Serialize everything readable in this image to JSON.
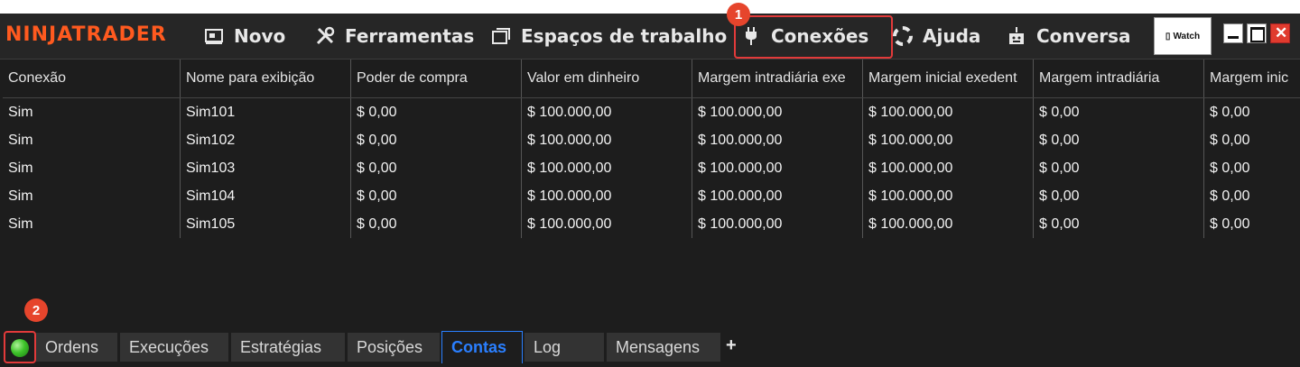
{
  "app": {
    "brand": "NINJATRADER"
  },
  "menu": {
    "novo": "Novo",
    "ferramentas": "Ferramentas",
    "espacos": "Espaços de trabalho",
    "conexoes": "Conexões",
    "ajuda": "Ajuda",
    "conversa": "Conversa",
    "watch": "Watch"
  },
  "annotations": {
    "badge1": "1",
    "badge2": "2"
  },
  "table": {
    "columns": [
      "Conexão",
      "Nome para exibição",
      "Poder de compra",
      "Valor em dinheiro",
      "Margem intradiária exe",
      "Margem inicial exedent",
      "Margem intradiária",
      "Margem inic"
    ],
    "rows": [
      [
        "Sim",
        "Sim101",
        "$ 0,00",
        "$ 100.000,00",
        "$ 100.000,00",
        "$ 100.000,00",
        "$ 0,00",
        "$ 0,00"
      ],
      [
        "Sim",
        "Sim102",
        "$ 0,00",
        "$ 100.000,00",
        "$ 100.000,00",
        "$ 100.000,00",
        "$ 0,00",
        "$ 0,00"
      ],
      [
        "Sim",
        "Sim103",
        "$ 0,00",
        "$ 100.000,00",
        "$ 100.000,00",
        "$ 100.000,00",
        "$ 0,00",
        "$ 0,00"
      ],
      [
        "Sim",
        "Sim104",
        "$ 0,00",
        "$ 100.000,00",
        "$ 100.000,00",
        "$ 100.000,00",
        "$ 0,00",
        "$ 0,00"
      ],
      [
        "Sim",
        "Sim105",
        "$ 0,00",
        "$ 100.000,00",
        "$ 100.000,00",
        "$ 100.000,00",
        "$ 0,00",
        "$ 0,00"
      ]
    ]
  },
  "tabs": {
    "ordens": "Ordens",
    "execucoes": "Execuções",
    "estrategias": "Estratégias",
    "posicoes": "Posições",
    "contas": "Contas",
    "log": "Log",
    "mensagens": "Mensagens",
    "add": "+"
  },
  "colors": {
    "brand": "#ff5a1f",
    "active_tab": "#2a7fff",
    "highlight": "#e23a3a",
    "badge": "#e6452c",
    "status_led": "#3ec42a"
  }
}
